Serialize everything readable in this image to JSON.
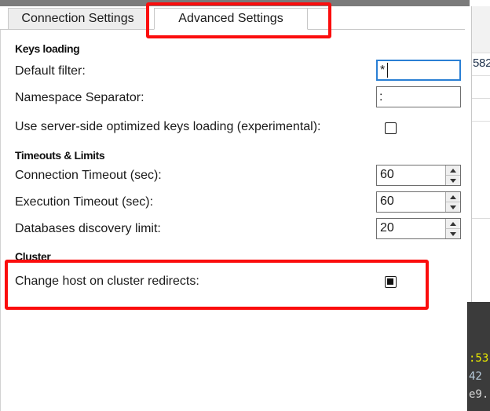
{
  "background": {
    "table_cell_text": "582",
    "console_lines": [
      ":53",
      "42",
      "e9."
    ]
  },
  "dialog": {
    "tabs": [
      {
        "label": "Connection Settings",
        "active": false
      },
      {
        "label": "Advanced Settings",
        "active": true
      }
    ],
    "groups": [
      {
        "heading": "Keys loading",
        "fields": [
          {
            "label": "Default filter:",
            "type": "text",
            "value": "*",
            "focused": true
          },
          {
            "label": "Namespace Separator:",
            "type": "text",
            "value": ":",
            "focused": false
          },
          {
            "label": "Use server-side optimized keys loading (experimental):",
            "type": "checkbox",
            "checked": false
          }
        ]
      },
      {
        "heading": "Timeouts & Limits",
        "fields": [
          {
            "label": "Connection Timeout (sec):",
            "type": "spinner",
            "value": "60"
          },
          {
            "label": "Execution Timeout (sec):",
            "type": "spinner",
            "value": "60"
          },
          {
            "label": "Databases discovery limit:",
            "type": "spinner",
            "value": "20"
          }
        ]
      },
      {
        "heading": "Cluster",
        "fields": [
          {
            "label": "Change host on cluster redirects:",
            "type": "checkbox",
            "checked": true
          }
        ]
      }
    ]
  },
  "annotations": {
    "color": "#fb0d0d",
    "highlighted_tab": "Advanced Settings",
    "highlighted_row": "Change host on cluster redirects:"
  }
}
